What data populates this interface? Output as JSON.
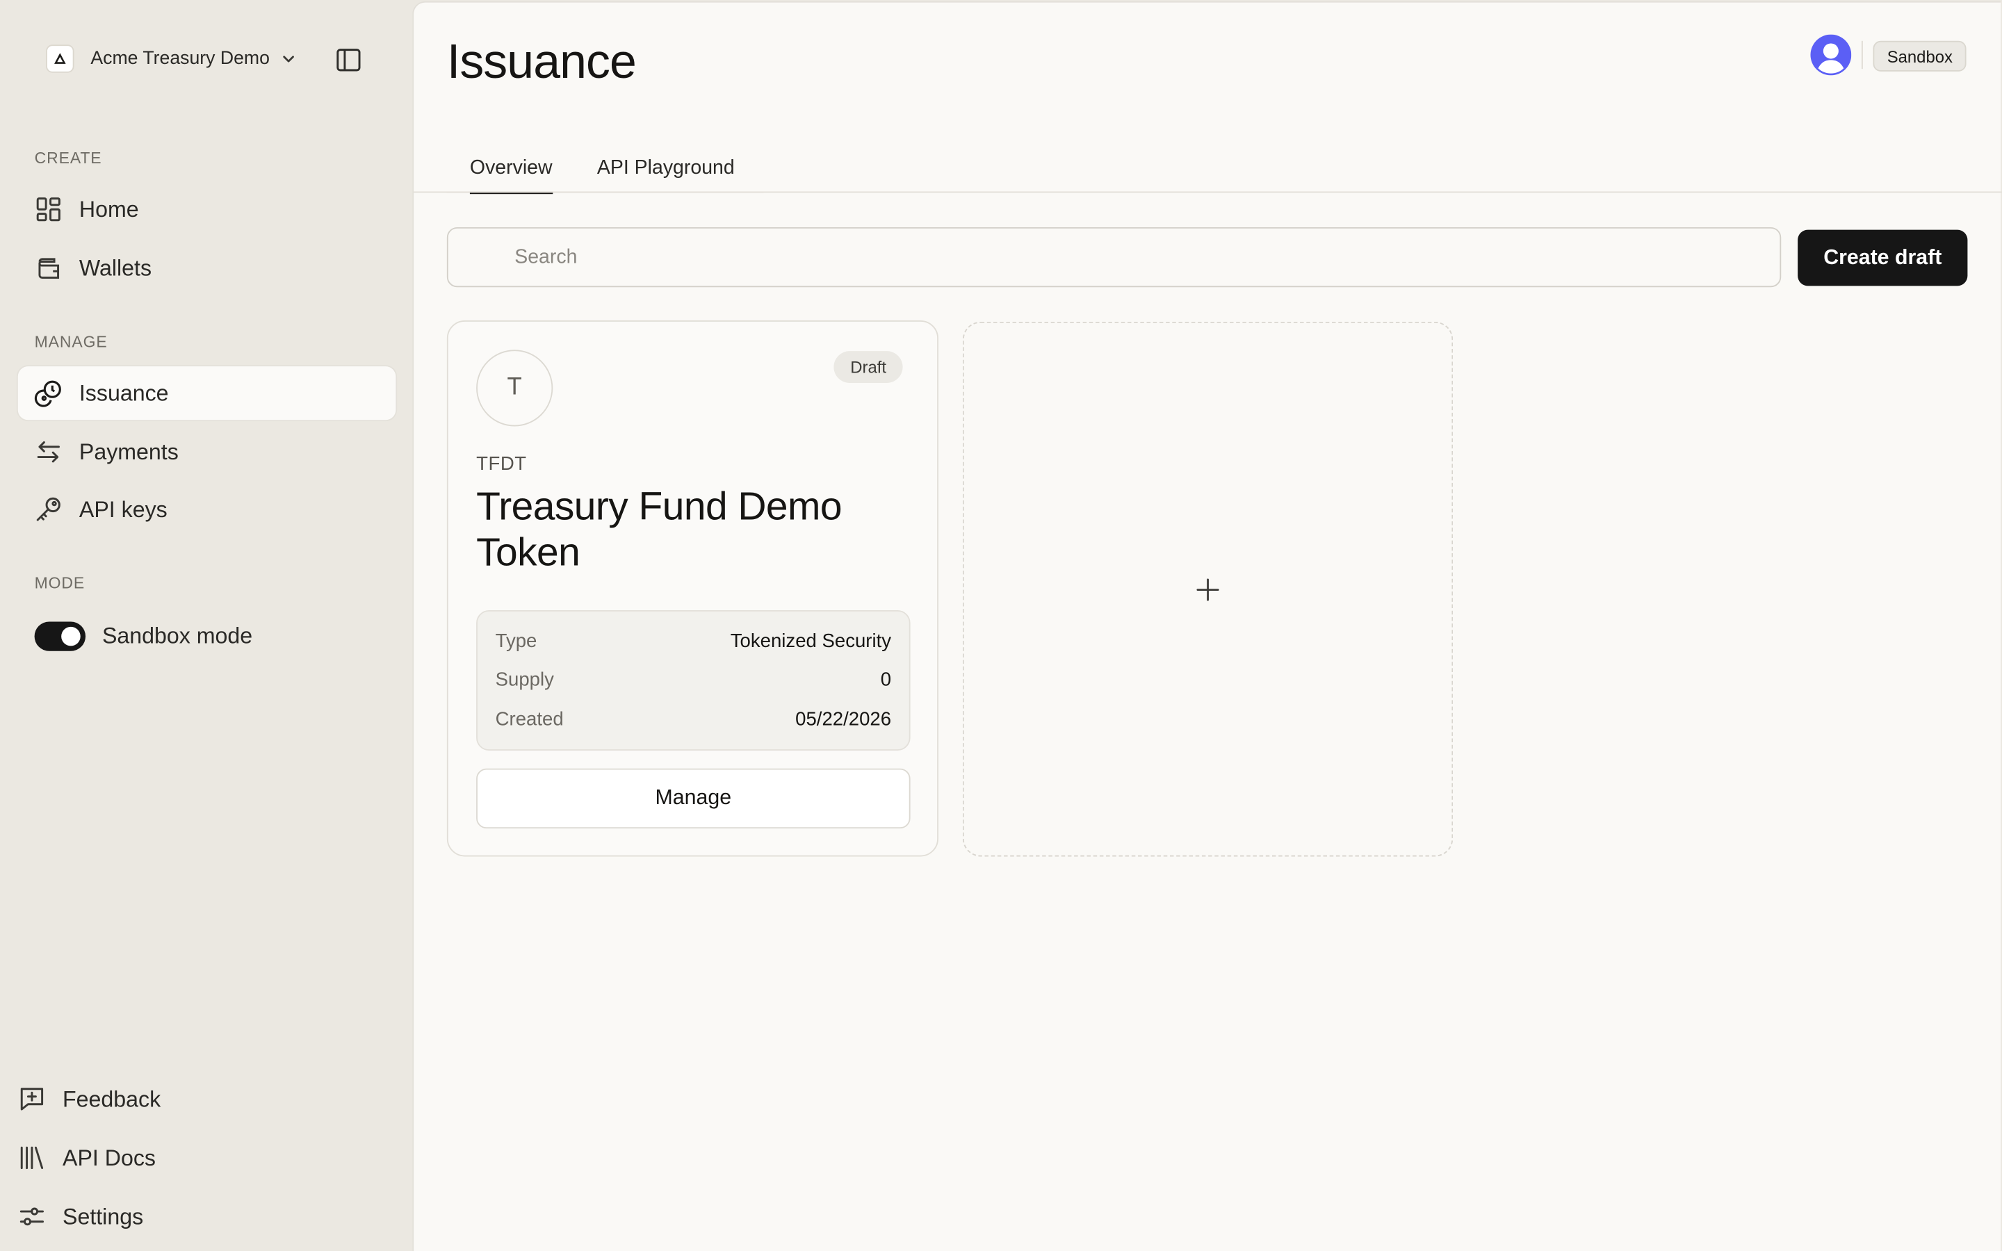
{
  "org": {
    "name": "Acme Treasury Demo",
    "logo_icon": "triangle-logo-icon"
  },
  "sidebar": {
    "sections": {
      "create": "CREATE",
      "manage": "MANAGE",
      "mode": "MODE"
    },
    "create_items": [
      {
        "label": "Home",
        "icon": "grid-icon"
      },
      {
        "label": "Wallets",
        "icon": "wallet-icon"
      }
    ],
    "manage_items": [
      {
        "label": "Issuance",
        "icon": "coins-icon",
        "active": true
      },
      {
        "label": "Payments",
        "icon": "transfer-arrows-icon"
      },
      {
        "label": "API keys",
        "icon": "key-icon"
      }
    ],
    "mode_toggle": {
      "label": "Sandbox mode",
      "on": true
    },
    "footer_items": [
      {
        "label": "Feedback",
        "icon": "message-plus-icon"
      },
      {
        "label": "API Docs",
        "icon": "library-icon"
      },
      {
        "label": "Settings",
        "icon": "sliders-icon"
      }
    ]
  },
  "header": {
    "title": "Issuance",
    "environment_badge": "Sandbox"
  },
  "tabs": [
    {
      "label": "Overview",
      "active": true
    },
    {
      "label": "API Playground",
      "active": false
    }
  ],
  "search": {
    "placeholder": "Search",
    "value": ""
  },
  "create_button_label": "Create draft",
  "token_card": {
    "avatar_letter": "T",
    "status": "Draft",
    "symbol": "TFDT",
    "name": "Treasury Fund Demo Token",
    "details": [
      {
        "key": "Type",
        "value": "Tokenized Security"
      },
      {
        "key": "Supply",
        "value": "0"
      },
      {
        "key": "Created",
        "value": "05/22/2026"
      }
    ],
    "manage_label": "Manage"
  },
  "add_card": {
    "icon": "plus-icon"
  },
  "colors": {
    "sidebar_bg": "#ebe8e1",
    "main_bg": "#faf9f6",
    "primary_button": "#161616",
    "avatar_accent": "#5b5ff5"
  }
}
